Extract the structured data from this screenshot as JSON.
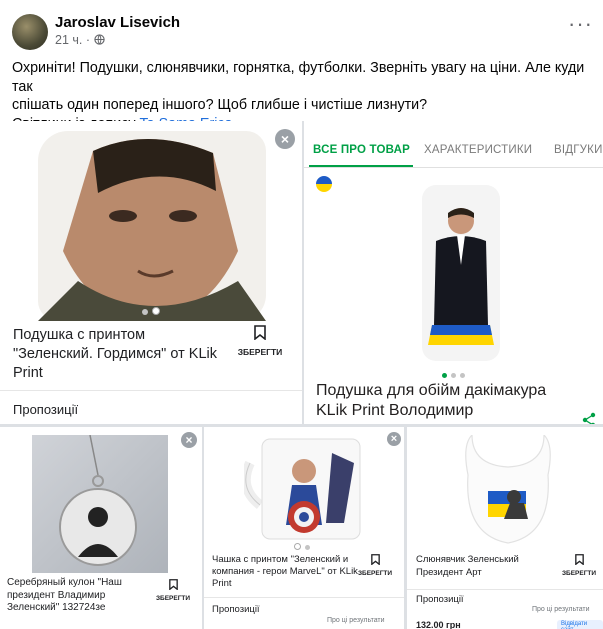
{
  "post": {
    "author": "Jaroslav Lisevich",
    "time": "21 ч.",
    "separator": "·",
    "more": "···",
    "text_line1": "Охриніти! Подушки, слюнявчики, горнятка, футболки. Зверніть увагу на ціни. Але куди так",
    "text_line2": "спішать один поперед іншого? Щоб глибше і чистіше лизнути?",
    "text_line3_prefix": "Світлини із допису ",
    "text_line3_link": "Ta Sama Erica"
  },
  "card1": {
    "title": "Подушка с принтом \"Зеленский. Гордимся\" от KLik Print",
    "save_label": "ЗБЕРЕГТИ",
    "footer": "Пропозиції",
    "close": "×"
  },
  "card2": {
    "tabs": [
      "ВСЕ ПРО ТОВАР",
      "ХАРАКТЕРИСТИКИ",
      "ВІДГУКИ"
    ],
    "title_line1": "Подушка для обійм дакімакура",
    "title_line2": "KLik Print Володимир",
    "accent": "#00a046"
  },
  "card3": {
    "title": "Серебряный кулон \"Наш президент Владимир Зеленский\" 132724зе",
    "save_label": "ЗБЕРЕГТИ",
    "close": "×"
  },
  "card4": {
    "title": "Чашка с принтом \"Зеленский и компания - герои MarveL\" от KLik Print",
    "save_label": "ЗБЕРЕГТИ",
    "footer": "Пропозиції",
    "about": "Про ці результати",
    "close": "×"
  },
  "card5": {
    "title": "Слюнявчик Зеленський Президент Арт",
    "save_label": "ЗБЕРЕГТИ",
    "footer": "Пропозиції",
    "about": "Про ці результати",
    "price": "132.00 грн",
    "shop": "Відвідати сайт"
  }
}
